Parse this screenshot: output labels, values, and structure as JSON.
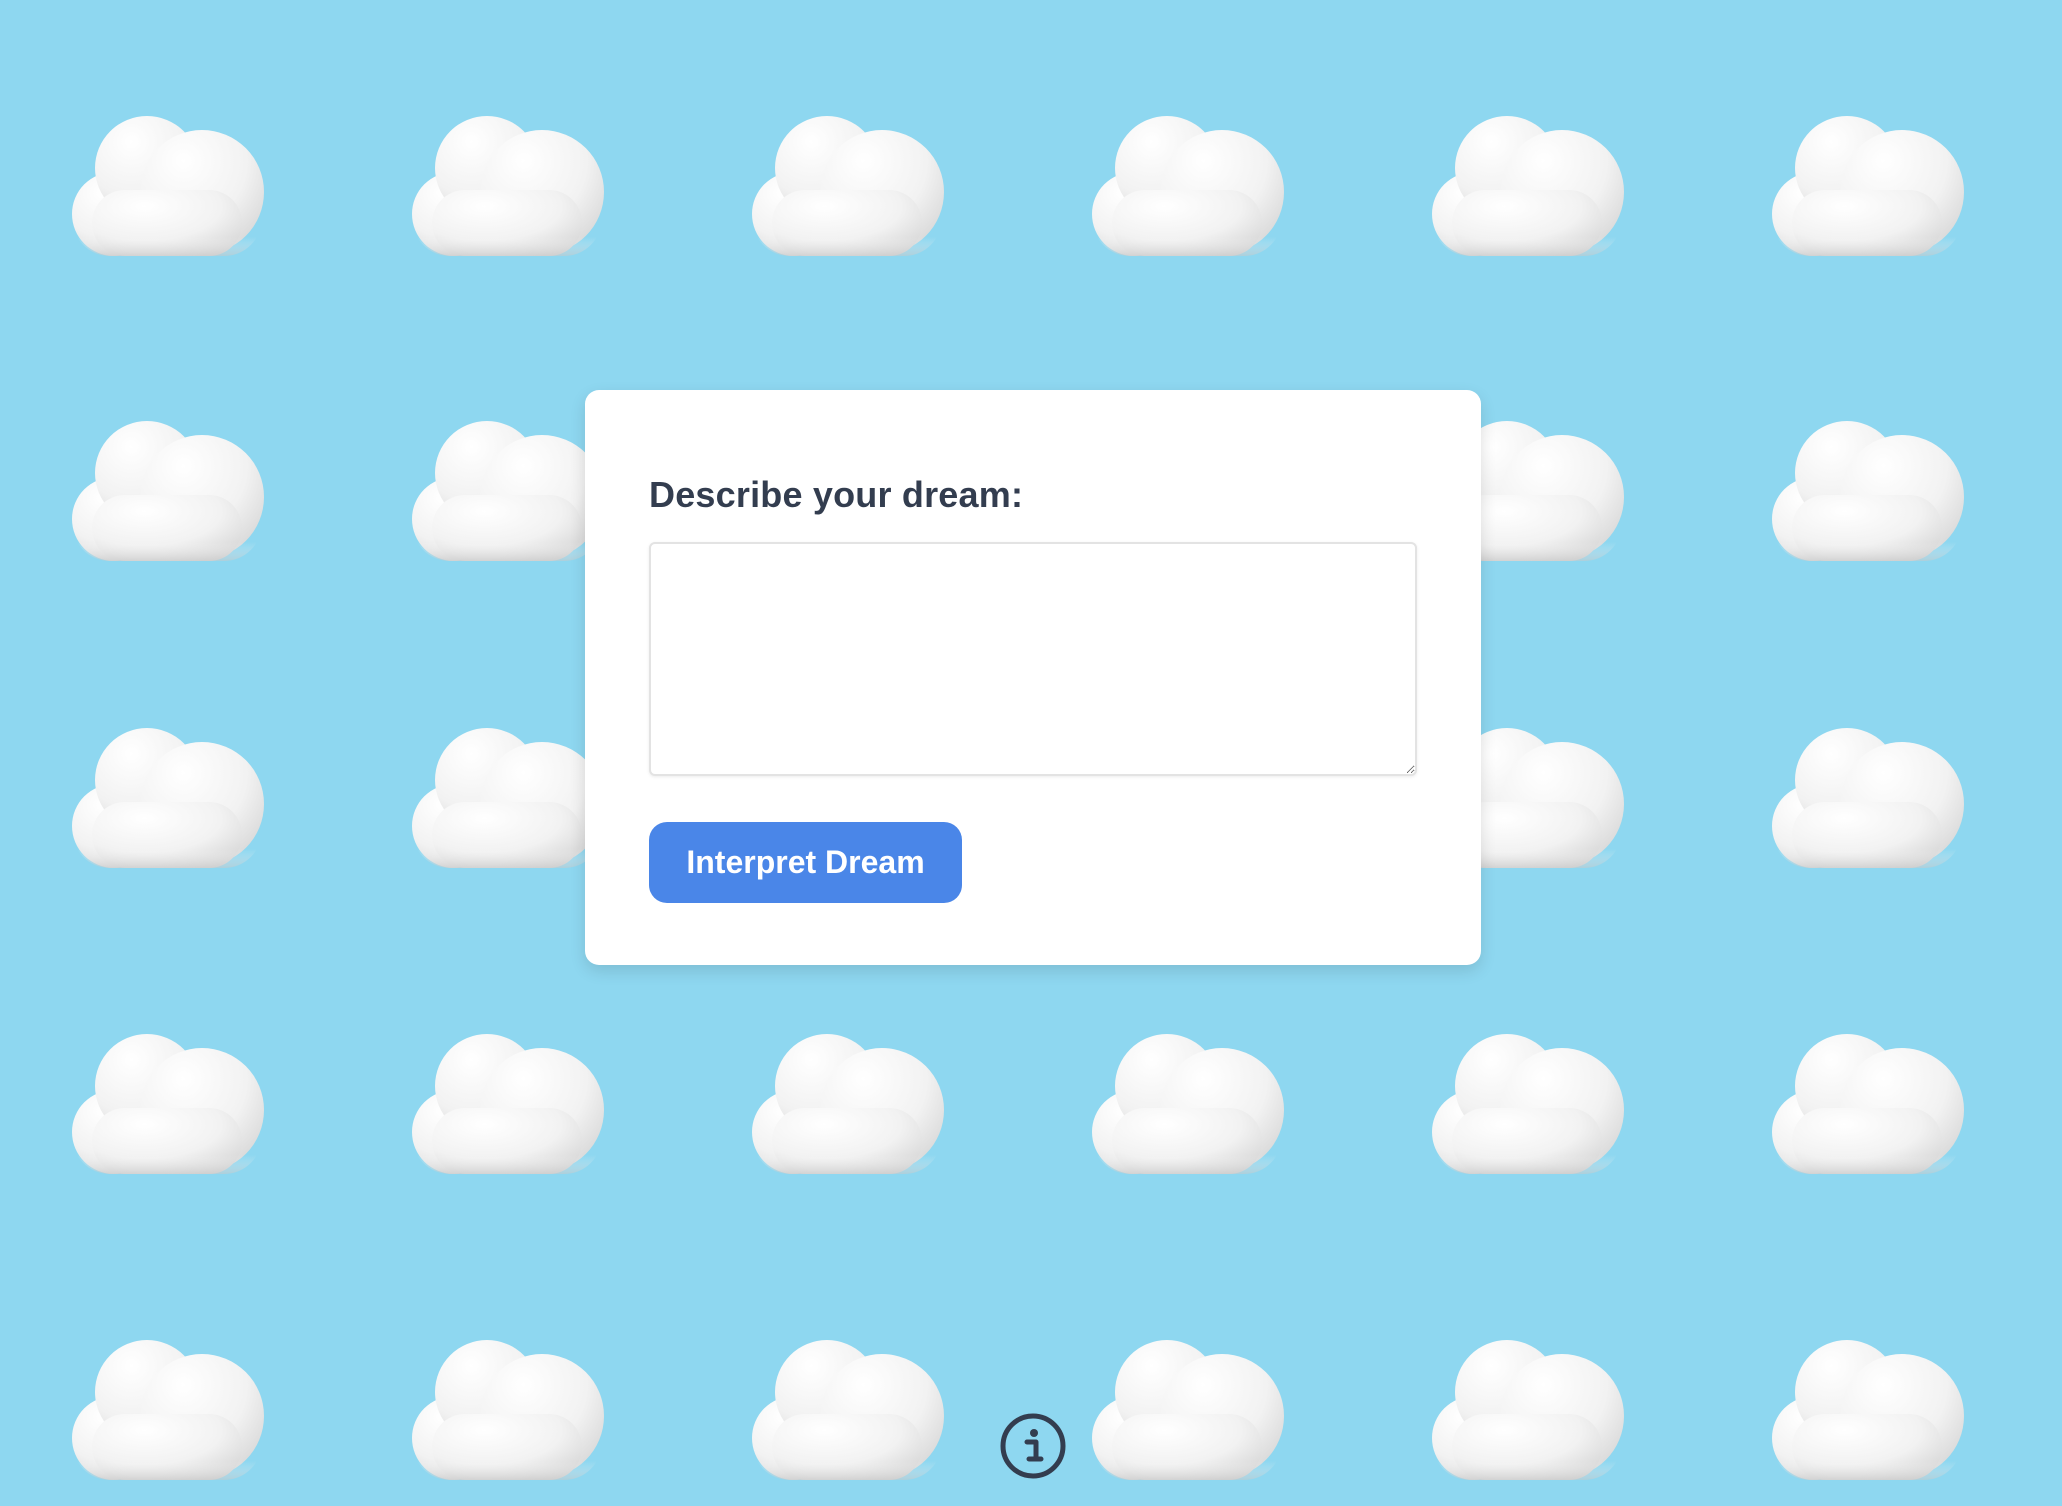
{
  "background_color": "#8ed7f0",
  "accent_color": "#4a86e8",
  "form": {
    "label": "Describe your dream:",
    "textarea_value": "",
    "textarea_placeholder": "",
    "submit_label": "Interpret Dream"
  },
  "footer": {
    "icon": "info-icon"
  },
  "decor": {
    "icon": "cloud-icon"
  }
}
